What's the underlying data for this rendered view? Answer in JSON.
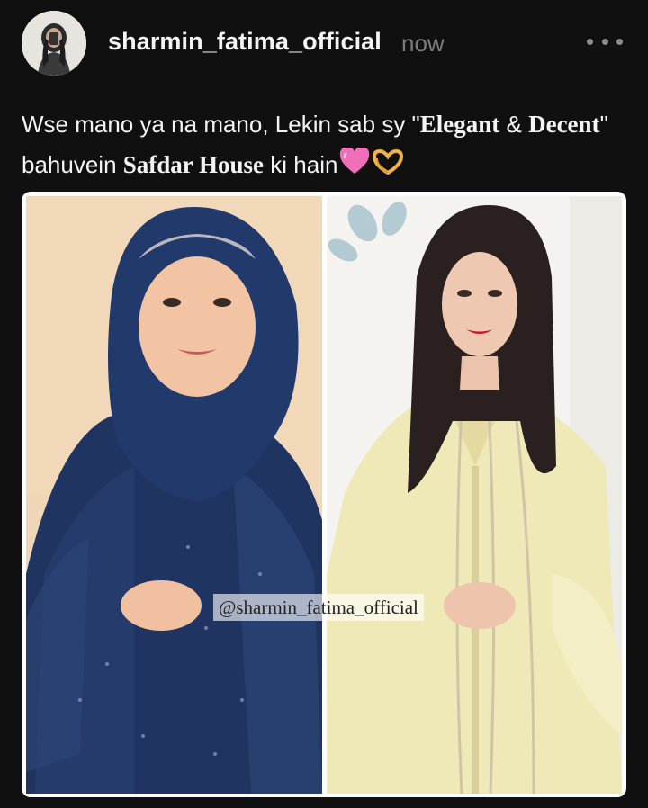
{
  "post": {
    "username": "sharmin_fatima_official",
    "timestamp": "now",
    "more_icon": "ellipsis-icon",
    "caption": {
      "part1": "Wse mano ya na mano, Lekin sab sy \"",
      "bold1": "Elegant",
      "part2": " & ",
      "bold2": "Decent",
      "part3": "\" bahuvein ",
      "bold3": "Safdar House",
      "part4": " ki hain",
      "emojis": [
        "pink-heart-icon",
        "heart-hands-icon"
      ]
    },
    "image": {
      "watermark": "@sharmin_fatima_official"
    }
  },
  "colors": {
    "background": "#101010",
    "text": "#f4f4f4",
    "muted": "#7b7b7b",
    "navy": "#1f3461",
    "cream": "#efe9b8"
  }
}
